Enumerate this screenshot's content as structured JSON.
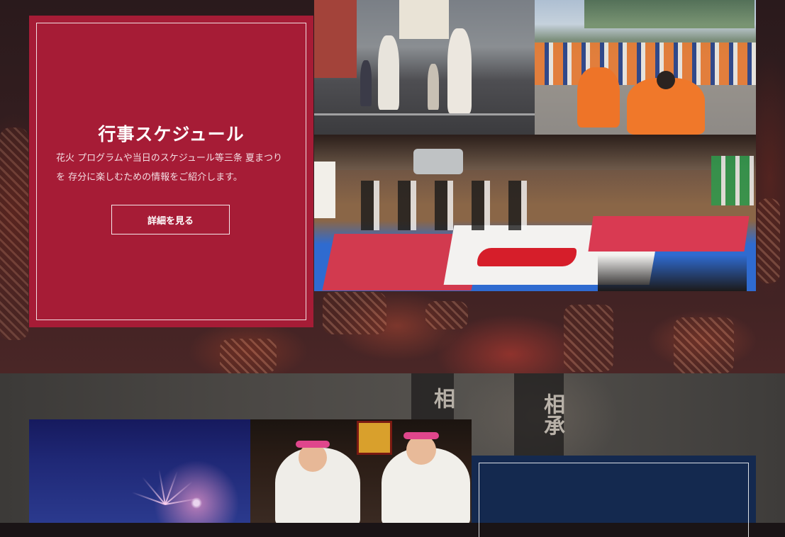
{
  "schedule_card": {
    "title": "行事スケジュール",
    "description": "花火 プログラムや当日のスケジュール等三条 夏まつりを 存分に楽しむための情報をご紹介します。",
    "button_label": "詳細を見る"
  },
  "colors": {
    "schedule_card_bg": "#a61c36",
    "navy_card_bg": "#14294f",
    "accent_white": "#ffffff"
  },
  "background_banners": [
    "相",
    "相承"
  ],
  "photos": [
    {
      "name": "yukata-parade-photo"
    },
    {
      "name": "orange-happi-dance-photo"
    },
    {
      "name": "calligraphy-performance-photo"
    },
    {
      "name": "fireworks-photo"
    },
    {
      "name": "festival-women-photo"
    }
  ]
}
